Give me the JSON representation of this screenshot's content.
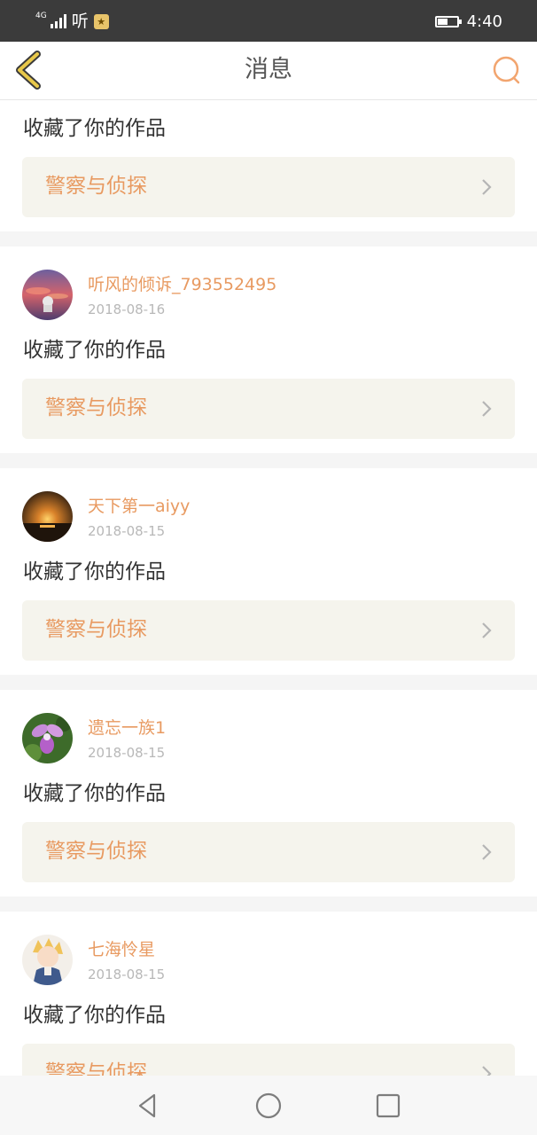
{
  "status_bar": {
    "network": "4G",
    "app_name": "听",
    "app_badge": "★",
    "battery_level": 0.5,
    "time": "4:40"
  },
  "header": {
    "title": "消息",
    "back_icon": "chevron-left-icon",
    "search_icon": "search-icon"
  },
  "colors": {
    "accent": "#e89a61",
    "back_icon": "#c9a21a",
    "card_bg": "#f5f4ed",
    "divider": "#f5f5f5"
  },
  "messages": [
    {
      "action": "收藏了你的作品",
      "work_title": "警察与侦探"
    },
    {
      "username": "听风的倾诉_793552495",
      "date": "2018-08-16",
      "action": "收藏了你的作品",
      "work_title": "警察与侦探"
    },
    {
      "username": "天下第一aiyy",
      "date": "2018-08-15",
      "action": "收藏了你的作品",
      "work_title": "警察与侦探"
    },
    {
      "username": "遗忘一族1",
      "date": "2018-08-15",
      "action": "收藏了你的作品",
      "work_title": "警察与侦探"
    },
    {
      "username": "七海怜星",
      "date": "2018-08-15",
      "action": "收藏了你的作品",
      "work_title": "警察与侦探"
    }
  ],
  "nav_bar": {
    "back_icon": "triangle-back-icon",
    "home_icon": "circle-home-icon",
    "recents_icon": "square-recents-icon"
  }
}
